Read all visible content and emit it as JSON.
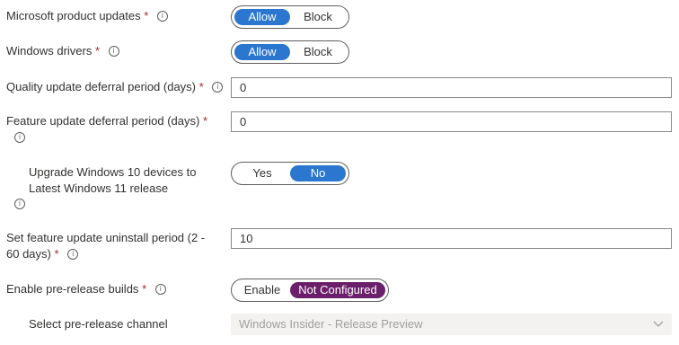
{
  "settings": {
    "ms_updates": {
      "label": "Microsoft product updates",
      "required": "*",
      "options": [
        "Allow",
        "Block"
      ],
      "selected": "Allow"
    },
    "windows_drivers": {
      "label": "Windows drivers",
      "required": "*",
      "options": [
        "Allow",
        "Block"
      ],
      "selected": "Allow"
    },
    "quality_deferral": {
      "label": "Quality update deferral period (days)",
      "required": "*",
      "value": "0"
    },
    "feature_deferral": {
      "label": "Feature update deferral period (days)",
      "required": "*",
      "value": "0"
    },
    "upgrade_win11": {
      "label_line1": "Upgrade Windows 10 devices to",
      "label_line2": "Latest Windows 11 release",
      "options": [
        "Yes",
        "No"
      ],
      "selected": "No"
    },
    "uninstall_period": {
      "label_line1": "Set feature update uninstall period (2 -",
      "label_line2": "60 days)",
      "required": "*",
      "value": "10"
    },
    "prerelease": {
      "label": "Enable pre-release builds",
      "required": "*",
      "options": [
        "Enable",
        "Not Configured"
      ],
      "selected": "Not Configured"
    },
    "channel": {
      "label": "Select pre-release channel",
      "value": "Windows Insider - Release Preview"
    }
  },
  "icons": {
    "info": "info-icon",
    "chevron": "chevron-down-icon"
  },
  "colors": {
    "accent_blue": "#2b76cf",
    "accent_purple": "#6b1f6a",
    "required": "#a4262c"
  }
}
